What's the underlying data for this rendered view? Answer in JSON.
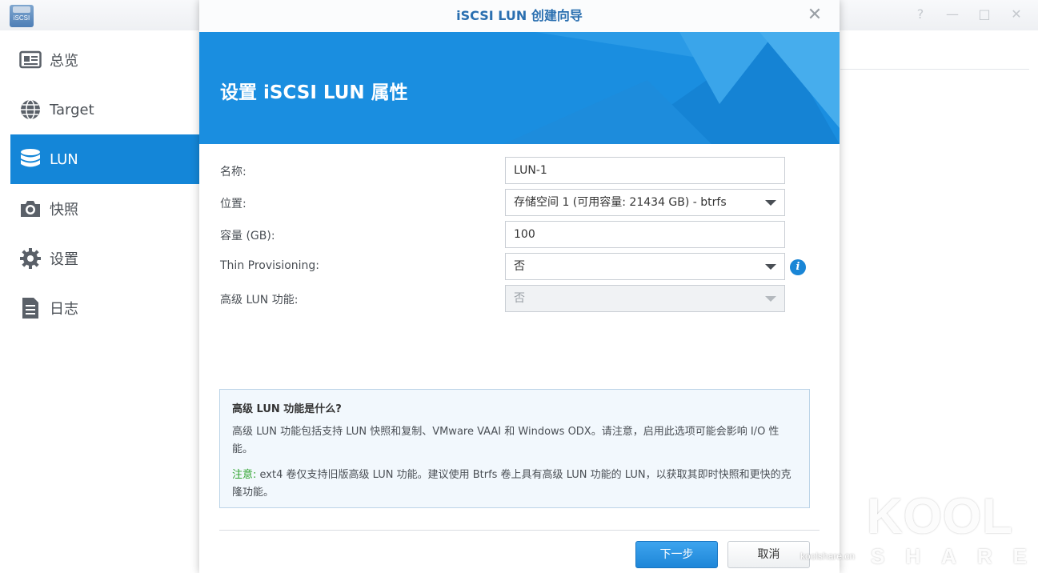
{
  "app": {
    "logo_text": "iSCSI",
    "window_controls": [
      "help-icon",
      "pin-icon",
      "maximize-icon",
      "close-icon"
    ]
  },
  "sidebar": {
    "items": [
      {
        "label": "总览",
        "icon": "overview-icon",
        "active": false
      },
      {
        "label": "Target",
        "icon": "globe-icon",
        "active": false
      },
      {
        "label": "LUN",
        "icon": "database-icon",
        "active": true
      },
      {
        "label": "快照",
        "icon": "camera-icon",
        "active": false
      },
      {
        "label": "设置",
        "icon": "gear-icon",
        "active": false
      },
      {
        "label": "日志",
        "icon": "log-icon",
        "active": false
      }
    ]
  },
  "dialog": {
    "title": "iSCSI LUN 创建向导",
    "banner_title": "设置 iSCSI LUN 属性",
    "fields": {
      "name_label": "名称:",
      "name_value": "LUN-1",
      "location_label": "位置:",
      "location_value": "存储空间 1 (可用容量: 21434 GB) - btrfs",
      "capacity_label": "容量 (GB):",
      "capacity_value": "100",
      "thin_label": "Thin Provisioning:",
      "thin_value": "否",
      "advanced_label": "高级 LUN 功能:",
      "advanced_value": "否"
    },
    "note": {
      "title": "高级 LUN 功能是什么?",
      "body": "高级 LUN 功能包括支持 LUN 快照和复制、VMware VAAI 和 Windows ODX。请注意，启用此选项可能会影响 I/O 性能。",
      "warn_prefix": "注意:",
      "warn_body": " ext4 卷仅支持旧版高级 LUN 功能。建议使用 Btrfs 卷上具有高级 LUN 功能的 LUN，以获取其即时快照和更快的克隆功能。"
    },
    "buttons": {
      "next": "下一步",
      "cancel": "取消"
    }
  },
  "watermark": {
    "big": "KOOL",
    "share": "SHARE",
    "site": "koolshare.cn"
  },
  "colors": {
    "accent": "#1486d8",
    "banner": "#1a8ee0",
    "warn_green": "#2ea32e"
  }
}
